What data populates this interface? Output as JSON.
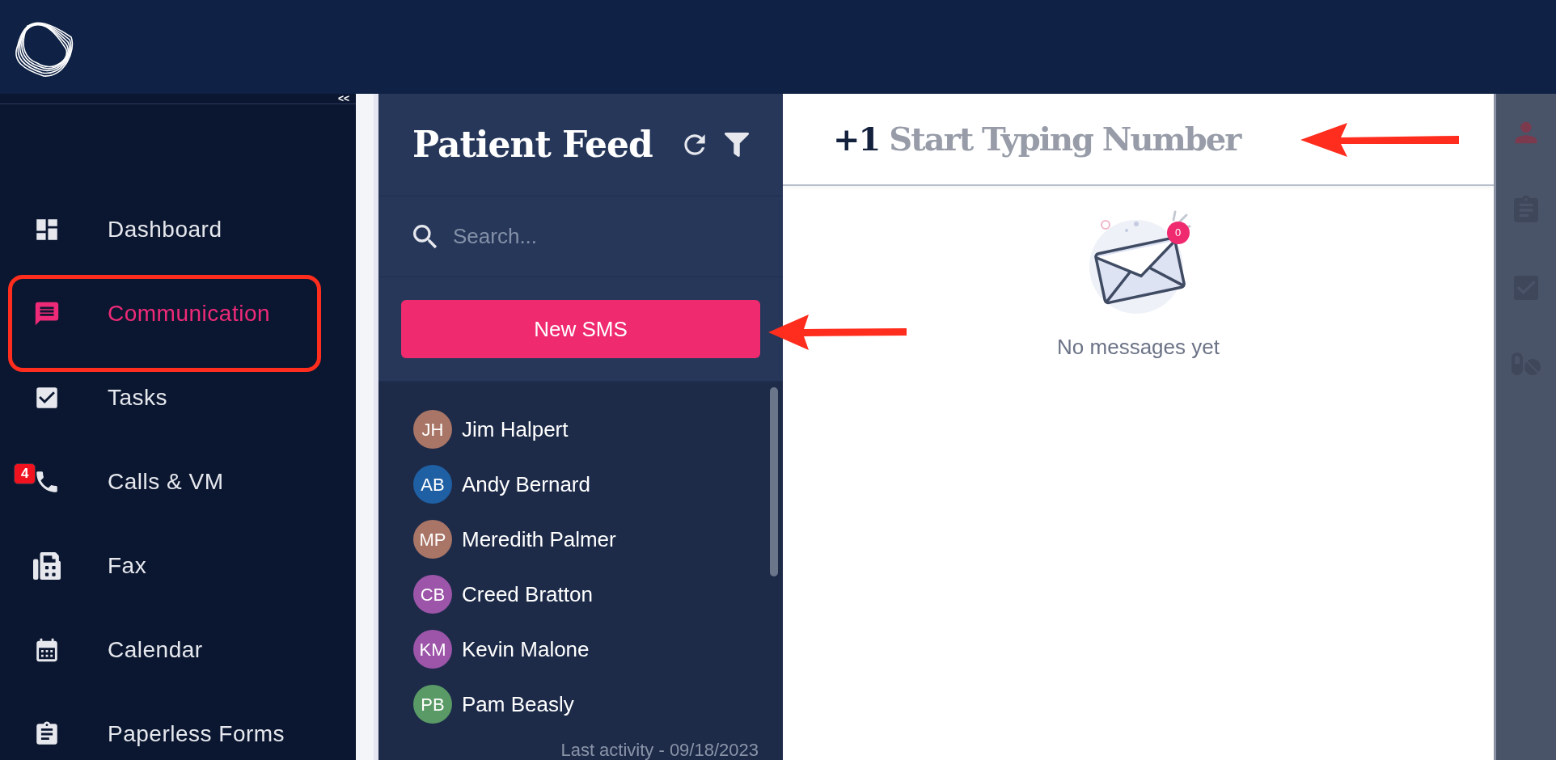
{
  "sidebar": {
    "collapse": "<<",
    "items": [
      {
        "label": "Dashboard",
        "selected": false
      },
      {
        "label": "Communication",
        "selected": true
      },
      {
        "label": "Tasks",
        "selected": false
      },
      {
        "label": "Calls & VM",
        "selected": false,
        "badge": "4"
      },
      {
        "label": "Fax",
        "selected": false
      },
      {
        "label": "Calendar",
        "selected": false
      },
      {
        "label": "Paperless Forms",
        "selected": false
      }
    ]
  },
  "feed": {
    "title": "Patient Feed",
    "search": {
      "placeholder": "Search..."
    },
    "new_button": "New SMS",
    "patients": [
      {
        "initials": "JH",
        "name": "Jim Halpert",
        "color": "#a87566"
      },
      {
        "initials": "AB",
        "name": "Andy Bernard",
        "color": "#1f5fa3"
      },
      {
        "initials": "MP",
        "name": "Meredith Palmer",
        "color": "#a87566"
      },
      {
        "initials": "CB",
        "name": "Creed Bratton",
        "color": "#9c55a8"
      },
      {
        "initials": "KM",
        "name": "Kevin Malone",
        "color": "#9c55a8"
      },
      {
        "initials": "PB",
        "name": "Pam Beasly",
        "color": "#5a9a66"
      }
    ],
    "last_activity": "Last activity - 09/18/2023"
  },
  "conversation": {
    "prefix": "+1",
    "placeholder": "Start Typing Number",
    "unread_badge": "0",
    "empty_text": "No messages yet"
  }
}
